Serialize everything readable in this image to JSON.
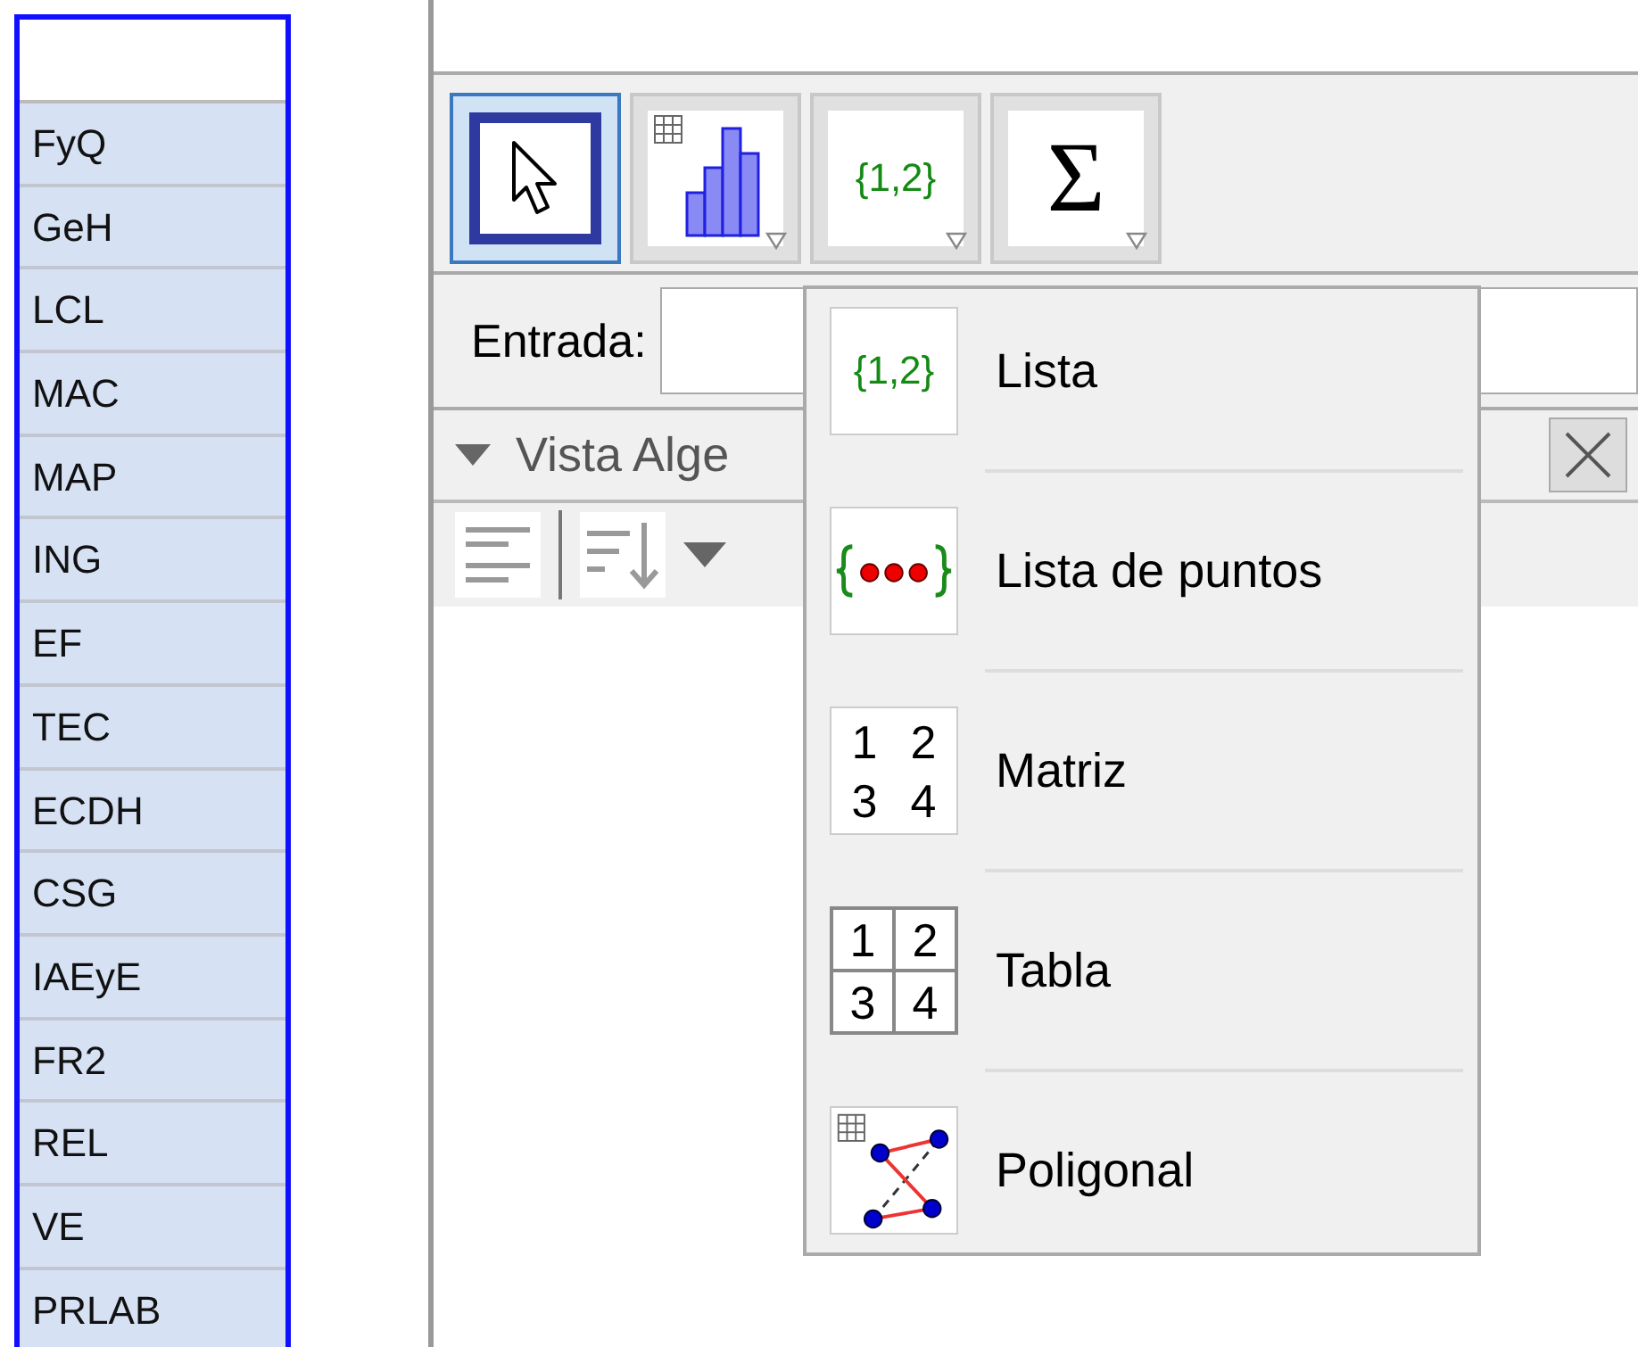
{
  "spreadsheet": {
    "selected": true,
    "cells": [
      "FyQ",
      "GeH",
      "LCL",
      "MAC",
      "MAP",
      "ING",
      "EF",
      "TEC",
      "ECDH",
      "CSG",
      "IAEyE",
      "FR2",
      "REL",
      "VE",
      "PRLAB"
    ]
  },
  "toolbar": {
    "tools": [
      {
        "kind": "move",
        "selected": true,
        "has_menu": false
      },
      {
        "kind": "chart",
        "selected": false,
        "has_menu": true
      },
      {
        "kind": "list",
        "icon_text": "{1,2}",
        "selected": false,
        "has_menu": true
      },
      {
        "kind": "sum",
        "icon_text": "Σ",
        "selected": false,
        "has_menu": true
      }
    ]
  },
  "input_bar": {
    "label": "Entrada:"
  },
  "algebra_view": {
    "title": "Vista Alge",
    "expanded": true
  },
  "menu": {
    "items": [
      {
        "kind": "list",
        "icon_text": "{1,2}",
        "label": "Lista"
      },
      {
        "kind": "points",
        "label": "Lista de puntos"
      },
      {
        "kind": "matrix",
        "icon_cells": [
          "1",
          "2",
          "3",
          "4"
        ],
        "label": "Matriz"
      },
      {
        "kind": "table",
        "icon_cells": [
          "1",
          "2",
          "3",
          "4"
        ],
        "label": "Tabla"
      },
      {
        "kind": "polyline",
        "label": "Poligonal"
      }
    ]
  }
}
